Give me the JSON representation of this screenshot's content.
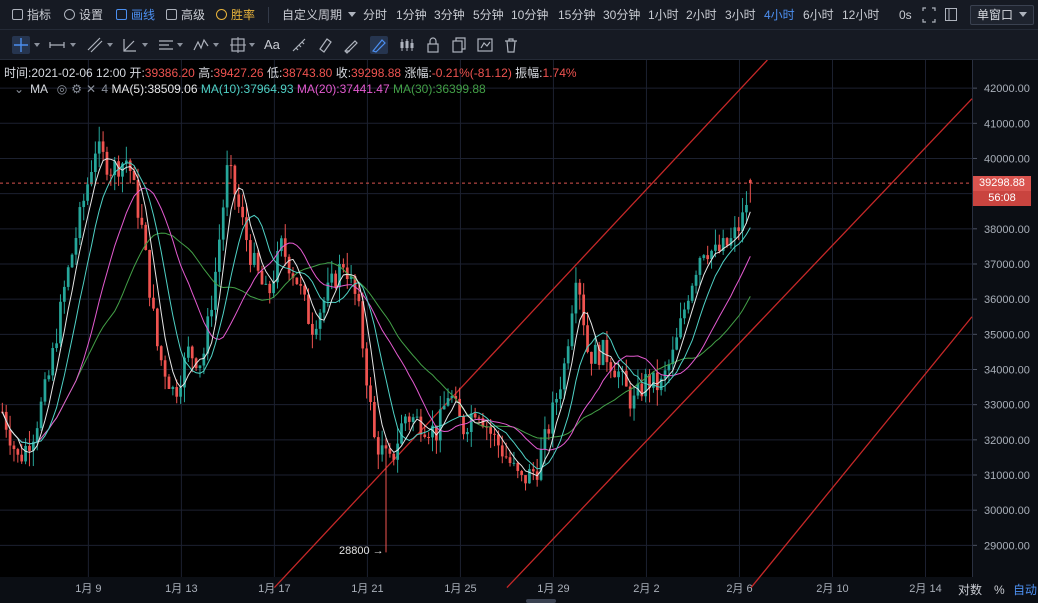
{
  "toolbar": {
    "items": [
      {
        "label": "指标",
        "icon": "indicator-icon"
      },
      {
        "label": "设置",
        "icon": "gear-icon"
      },
      {
        "label": "画线",
        "icon": "pen-icon"
      },
      {
        "label": "高级",
        "icon": "advanced-icon"
      },
      {
        "label": "胜率",
        "icon": "winrate-icon"
      }
    ],
    "custom_period": "自定义周期",
    "periods": [
      "分时",
      "1分钟",
      "3分钟",
      "5分钟",
      "10分钟",
      "15分钟",
      "30分钟",
      "1小时",
      "2小时",
      "3小时",
      "4小时",
      "6小时",
      "12小时"
    ],
    "selected_period": "4小时",
    "countdown": "0s",
    "window_mode": "单窗口"
  },
  "draw_tools": [
    "crosshair-icon",
    "horizontal-line-icon",
    "trend-line-icon",
    "angle-icon",
    "parallel-lines-icon",
    "fibonacci-icon",
    "rectangle-icon",
    "text-icon",
    "measure-icon",
    "magnet-icon",
    "eraser-icon",
    "draw-mode-icon",
    "lock-icon",
    "copy-icon",
    "settings-icon",
    "delete-icon"
  ],
  "draw_text_tool": "Aa",
  "info": {
    "time_label": "时间:",
    "time": "2021-02-06 12:00",
    "open_label": "开:",
    "open": "39386.20",
    "high_label": "高:",
    "high": "39427.26",
    "low_label": "低:",
    "low": "38743.80",
    "close_label": "收:",
    "close": "39298.88",
    "change_label": "涨幅:",
    "change": "-0.21%(-81.12)",
    "amplitude_label": "振幅:",
    "amplitude": "1.74%"
  },
  "ma": {
    "name": "MA",
    "period_count": "4",
    "ma5": "MA(5):38509.06",
    "ma10": "MA(10):37964.93",
    "ma20": "MA(20):37441.47",
    "ma30": "MA(30):36399.88"
  },
  "price_tag": {
    "price": "39298.88",
    "countdown": "56:08"
  },
  "annotation": "28800 →",
  "bottom": {
    "log_label": "对数",
    "percent_label": "%",
    "auto_label": "自动"
  },
  "colors": {
    "up": "#26a69a",
    "down": "#ef5350",
    "ma5": "#e6e6e6",
    "ma10": "#4fd1c5",
    "ma20": "#e45ad0",
    "ma30": "#43a047",
    "channel": "#c62828",
    "accent": "#4c8ff0"
  },
  "chart_data": {
    "type": "candlestick",
    "title": "",
    "y_ticks": [
      29000,
      30000,
      31000,
      32000,
      33000,
      34000,
      35000,
      36000,
      37000,
      38000,
      39000,
      40000,
      41000,
      42000
    ],
    "y_tick_labels": [
      "29000.00",
      "30000.00",
      "31000.00",
      "32000.00",
      "33000.00",
      "34000.00",
      "35000.00",
      "36000.00",
      "37000.00",
      "38000.00",
      "39000.00",
      "40000.00",
      "41000.00",
      "42000.00"
    ],
    "ylim": [
      28100,
      42800
    ],
    "x_tick_labels": [
      "1月 9",
      "1月 13",
      "1月 17",
      "1月 21",
      "1月 25",
      "1月 29",
      "2月 2",
      "2月 6",
      "2月 10",
      "2月 14"
    ],
    "x_tick_days": [
      9,
      13,
      17,
      21,
      25,
      29,
      33,
      37,
      41,
      45
    ],
    "xlim_days": [
      5.2,
      47.0
    ],
    "current_price": 39298.88,
    "annotated_low": 28800,
    "channel_lines": [
      {
        "from": [
          17.0,
          27800
        ],
        "to": [
          38.2,
          42800
        ]
      },
      {
        "from": [
          27.0,
          27800
        ],
        "to": [
          47.0,
          41700
        ]
      },
      {
        "from": [
          37.5,
          27800
        ],
        "to": [
          47.0,
          35500
        ]
      }
    ],
    "key_points": [
      [
        5.3,
        32800
      ],
      [
        6.0,
        31400
      ],
      [
        6.7,
        32300
      ],
      [
        7.3,
        33800
      ],
      [
        8.0,
        36400
      ],
      [
        8.7,
        38500
      ],
      [
        9.3,
        40300
      ],
      [
        10.0,
        39700
      ],
      [
        10.7,
        40000
      ],
      [
        11.3,
        38000
      ],
      [
        12.0,
        34500
      ],
      [
        12.7,
        33300
      ],
      [
        13.3,
        34500
      ],
      [
        13.9,
        34200
      ],
      [
        14.4,
        36400
      ],
      [
        15.0,
        39800
      ],
      [
        15.5,
        38500
      ],
      [
        16.0,
        37200
      ],
      [
        16.7,
        36000
      ],
      [
        17.3,
        37500
      ],
      [
        18.0,
        36500
      ],
      [
        18.6,
        35200
      ],
      [
        19.3,
        36200
      ],
      [
        20.0,
        37100
      ],
      [
        20.6,
        35800
      ],
      [
        21.3,
        32000
      ],
      [
        22.0,
        31300
      ],
      [
        22.6,
        32700
      ],
      [
        23.3,
        32500
      ],
      [
        24.0,
        32200
      ],
      [
        24.5,
        33400
      ],
      [
        25.1,
        32300
      ],
      [
        25.7,
        33000
      ],
      [
        26.3,
        32200
      ],
      [
        27.0,
        31500
      ],
      [
        27.6,
        30800
      ],
      [
        28.3,
        31200
      ],
      [
        28.9,
        32600
      ],
      [
        29.5,
        34200
      ],
      [
        30.0,
        37000
      ],
      [
        30.5,
        34400
      ],
      [
        31.2,
        34500
      ],
      [
        31.8,
        33900
      ],
      [
        32.4,
        33000
      ],
      [
        33.0,
        33700
      ],
      [
        33.6,
        33500
      ],
      [
        34.2,
        34500
      ],
      [
        34.8,
        36200
      ],
      [
        35.4,
        37500
      ],
      [
        36.0,
        37300
      ],
      [
        36.6,
        37600
      ],
      [
        37.1,
        38200
      ],
      [
        37.5,
        39300
      ]
    ],
    "ma_last": {
      "ma5": 38509.06,
      "ma10": 37964.93,
      "ma20": 37441.47,
      "ma30": 36399.88
    }
  }
}
